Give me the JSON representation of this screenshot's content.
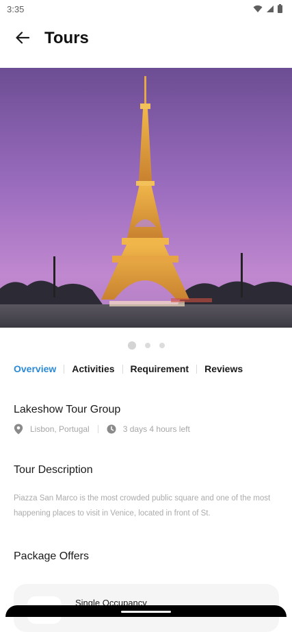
{
  "status_bar": {
    "time": "3:35",
    "icons": [
      "wifi-icon",
      "signal-icon",
      "battery-icon"
    ]
  },
  "app_bar": {
    "back_icon": "arrow-left-icon",
    "title": "Tours"
  },
  "hero": {
    "image": "eiffel-tower-at-dusk",
    "carousel": {
      "total": 3,
      "active": 1
    }
  },
  "tabs": [
    {
      "label": "Overview",
      "active": true
    },
    {
      "label": "Activities",
      "active": false
    },
    {
      "label": "Requirement",
      "active": false
    },
    {
      "label": "Reviews",
      "active": false
    }
  ],
  "tour": {
    "name": "Lakeshow Tour Group",
    "location": "Lisbon, Portugal",
    "time_left": "3 days 4 hours left",
    "location_icon": "map-pin-icon",
    "time_icon": "clock-icon"
  },
  "description": {
    "title": "Tour Description",
    "text": "Piazza San Marco is the most crowded public square and one of the most happening places to visit in Venice, located in front of St."
  },
  "packages": {
    "title": "Package Offers",
    "items": [
      {
        "label": "Single Occupancy"
      }
    ]
  },
  "colors": {
    "accent": "#2a8ad6",
    "text": "#1a1a1a",
    "muted": "#ababab",
    "card_bg": "#f5f5f5"
  }
}
